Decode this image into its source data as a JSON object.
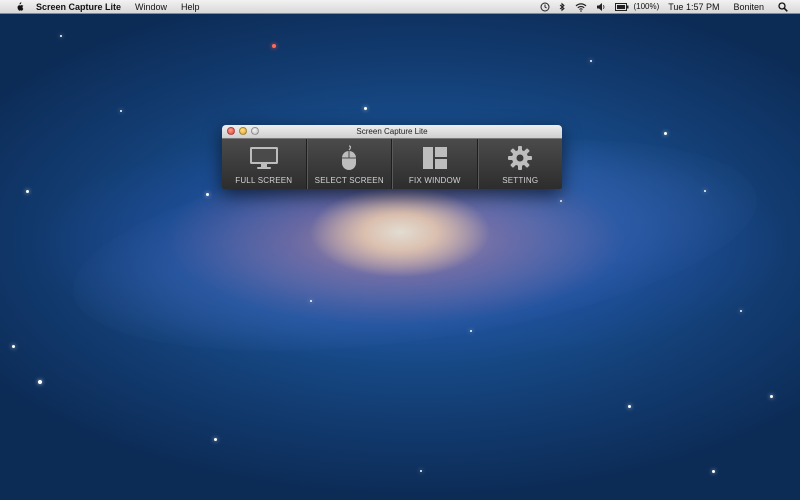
{
  "menubar": {
    "apple_icon": "apple-logo-icon",
    "app_name": "Screen Capture Lite",
    "menus": [
      "Window",
      "Help"
    ],
    "status": {
      "time_machine_icon": "time-machine-icon",
      "bluetooth_icon": "bluetooth-icon",
      "wifi_icon": "wifi-icon",
      "volume_icon": "volume-icon",
      "battery_icon": "battery-icon",
      "battery_percent": "(100%)",
      "clock": "Tue 1:57 PM",
      "user": "Boniten",
      "spotlight_icon": "search-icon"
    }
  },
  "window": {
    "title": "Screen Capture Lite",
    "tools": [
      {
        "label": "FULL SCREEN",
        "icon": "monitor-icon"
      },
      {
        "label": "SELECT SCREEN",
        "icon": "mouse-icon"
      },
      {
        "label": "FIX WINDOW",
        "icon": "window-layout-icon"
      },
      {
        "label": "SETTING",
        "icon": "gear-icon"
      }
    ]
  },
  "colors": {
    "toolbar_top": "#4b4b4b",
    "toolbar_bottom": "#2c2c2c",
    "label": "#d2d2d2",
    "icon": "#bdbdbd",
    "desktop": "#184d8c"
  }
}
